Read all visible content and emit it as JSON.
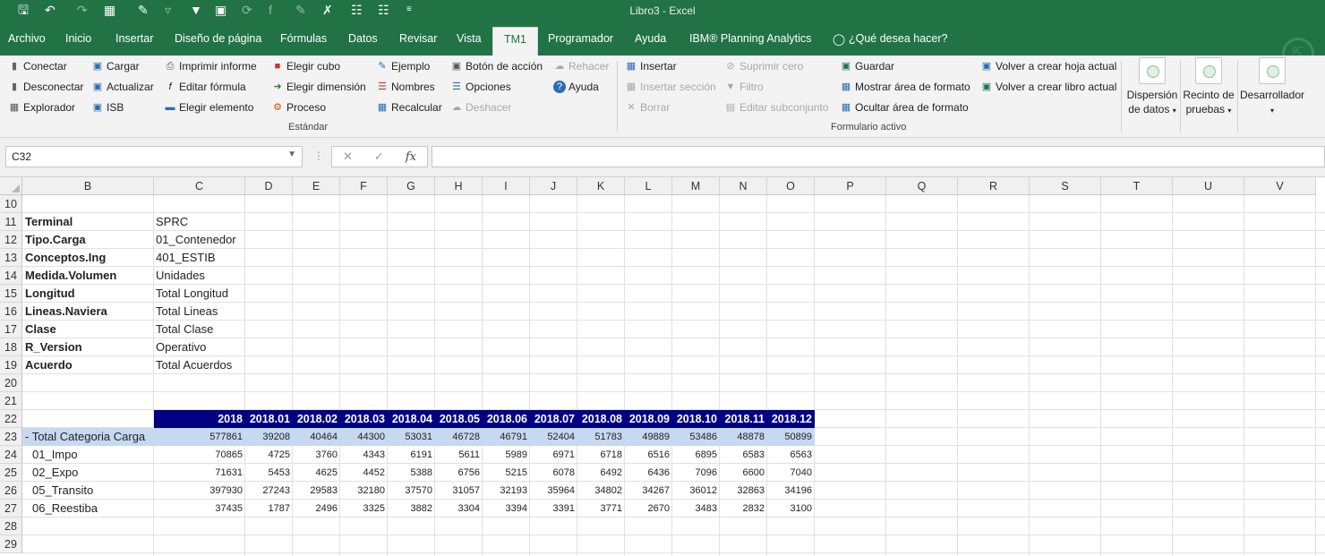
{
  "window": {
    "title": "Libro3  -  Excel"
  },
  "qat_icons": [
    "save-icon",
    "undo-icon",
    "redo-icon",
    "table-icon",
    "eraser-icon",
    "clear-filter-icon",
    "filter-icon",
    "form-icon",
    "refresh-icon",
    "formula-icon",
    "edit-icon",
    "tools-icon",
    "hierarchy-icon",
    "hierarchy2-icon",
    "customize-icon"
  ],
  "tabs": [
    "Archivo",
    "Inicio",
    "Insertar",
    "Diseño de página",
    "Fórmulas",
    "Datos",
    "Revisar",
    "Vista",
    "TM1",
    "Programador",
    "Ayuda",
    "IBM® Planning Analytics",
    "¿Qué desea hacer?"
  ],
  "active_tab": "TM1",
  "ribbon": {
    "estandar": {
      "label": "Estándar",
      "buttons": [
        "Conectar",
        "Desconectar",
        "Explorador",
        "Cargar",
        "Actualizar",
        "ISB",
        "Imprimir informe",
        "Editar fórmula",
        "Elegir elemento",
        "Elegir cubo",
        "Elegir dimensión",
        "Proceso",
        "Ejemplo",
        "Nombres",
        "Recalcular",
        "Botón de acción",
        "Opciones",
        "Deshacer",
        "Rehacer",
        "Ayuda"
      ]
    },
    "formulario": {
      "label": "Formulario activo",
      "buttons": [
        "Insertar",
        "Insertar sección",
        "Borrar",
        "Suprimir cero",
        "Filtro",
        "Editar subconjunto",
        "Guardar",
        "Mostrar área de formato",
        "Ocultar área de formato",
        "Volver a crear hoja actual",
        "Volver a crear libro actual"
      ]
    },
    "big_buttons": [
      {
        "line1": "Dispersión",
        "line2": "de datos"
      },
      {
        "line1": "Recinto de",
        "line2": "pruebas"
      },
      {
        "line1": "Desarrollador",
        "line2": ""
      }
    ]
  },
  "formula_bar": {
    "name_box": "C32",
    "formula": ""
  },
  "columns": [
    "B",
    "C",
    "D",
    "E",
    "F",
    "G",
    "H",
    "I",
    "J",
    "K",
    "L",
    "M",
    "N",
    "O",
    "P",
    "Q",
    "R",
    "S",
    "T",
    "U",
    "V"
  ],
  "rows": [
    "10",
    "11",
    "12",
    "13",
    "14",
    "15",
    "16",
    "17",
    "18",
    "19",
    "20",
    "21",
    "22",
    "23",
    "24",
    "25",
    "26",
    "27",
    "28",
    "29"
  ],
  "params": [
    {
      "label": "Terminal",
      "value": "SPRC"
    },
    {
      "label": "Tipo.Carga",
      "value": "01_Contenedor"
    },
    {
      "label": "Conceptos.Ing",
      "value": "401_ESTIB"
    },
    {
      "label": "Medida.Volumen",
      "value": "Unidades"
    },
    {
      "label": "Longitud",
      "value": "Total Longitud"
    },
    {
      "label": "Lineas.Naviera",
      "value": "Total Lineas"
    },
    {
      "label": "Clase",
      "value": "Total Clase"
    },
    {
      "label": "R_Version",
      "value": "Operativo"
    },
    {
      "label": "Acuerdo",
      "value": "Total Acuerdos"
    }
  ],
  "table": {
    "headers": [
      "2018",
      "2018.01",
      "2018.02",
      "2018.03",
      "2018.04",
      "2018.05",
      "2018.06",
      "2018.07",
      "2018.08",
      "2018.09",
      "2018.10",
      "2018.11",
      "2018.12"
    ],
    "rows": [
      {
        "label": "- Total Categoria Carga",
        "values": [
          "577861",
          "39208",
          "40464",
          "44300",
          "53031",
          "46728",
          "46791",
          "52404",
          "51783",
          "49889",
          "53486",
          "48878",
          "50899"
        ]
      },
      {
        "label": "01_Impo",
        "values": [
          "70865",
          "4725",
          "3760",
          "4343",
          "6191",
          "5611",
          "5989",
          "6971",
          "6718",
          "6516",
          "6895",
          "6583",
          "6563"
        ]
      },
      {
        "label": "02_Expo",
        "values": [
          "71631",
          "5453",
          "4625",
          "4452",
          "5388",
          "6756",
          "5215",
          "6078",
          "6492",
          "6436",
          "7096",
          "6600",
          "7040"
        ]
      },
      {
        "label": "05_Transito",
        "values": [
          "397930",
          "27243",
          "29583",
          "32180",
          "37570",
          "31057",
          "32193",
          "35964",
          "34802",
          "34267",
          "36012",
          "32863",
          "34196"
        ]
      },
      {
        "label": "06_Reestiba",
        "values": [
          "37435",
          "1787",
          "2496",
          "3325",
          "3882",
          "3304",
          "3394",
          "3391",
          "3771",
          "2670",
          "3483",
          "2832",
          "3100"
        ]
      }
    ]
  }
}
